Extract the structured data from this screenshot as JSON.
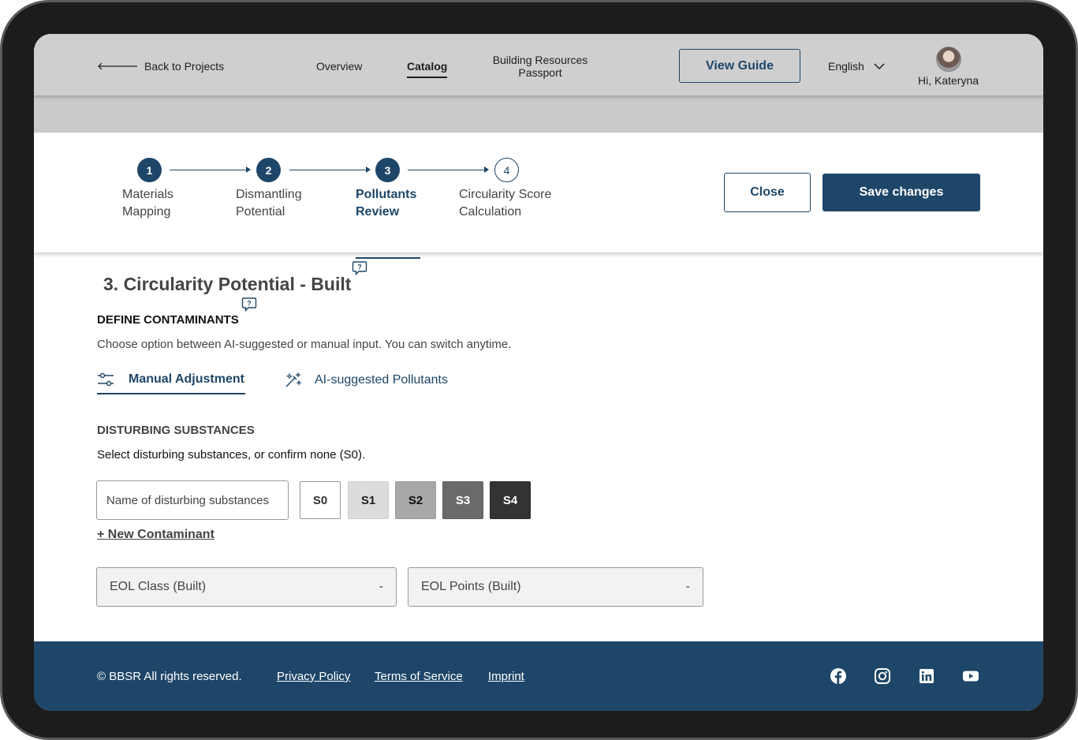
{
  "header": {
    "back_label": "Back to Projects",
    "nav": {
      "overview": "Overview",
      "catalog": "Catalog",
      "brp_line1": "Building Resources",
      "brp_line2": "Passport"
    },
    "view_guide": "View Guide",
    "language": "English",
    "greeting": "Hi, Kateryna"
  },
  "stepper": {
    "steps": [
      {
        "number": "1",
        "line1": "Materials",
        "line2": "Mapping",
        "state": "completed"
      },
      {
        "number": "2",
        "line1": "Dismantling",
        "line2": "Potential",
        "state": "completed"
      },
      {
        "number": "3",
        "line1": "Pollutants",
        "line2": "Review",
        "state": "active"
      },
      {
        "number": "4",
        "line1": "Circularity Score",
        "line2": "Calculation",
        "state": "upcoming"
      }
    ],
    "close_label": "Close",
    "save_label": "Save changes"
  },
  "main": {
    "section_title": "3. Circularity Potential - Built",
    "define_title": "DEFINE CONTAMINANTS",
    "define_desc": "Choose option between AI-suggested or manual input. You can switch anytime.",
    "tabs": {
      "manual": "Manual Adjustment",
      "ai": "AI-suggested Pollutants"
    },
    "disturbing_title": "DISTURBING SUBSTANCES",
    "disturbing_desc": "Select disturbing substances, or confirm none (S0).",
    "name_placeholder": "Name of disturbing substances",
    "levels": [
      "S0",
      "S1",
      "S2",
      "S3",
      "S4"
    ],
    "new_contaminant": "+ New Contaminant",
    "eol_class_label": "EOL Class (Built)",
    "eol_class_value": "-",
    "eol_points_label": "EOL Points (Built)",
    "eol_points_value": "-"
  },
  "footer": {
    "copyright": "© BBSR All rights reserved.",
    "privacy": "Privacy Policy",
    "terms": "Terms of Service",
    "imprint": "Imprint",
    "social_icons": [
      "facebook-icon",
      "instagram-icon",
      "linkedin-icon",
      "youtube-icon"
    ]
  },
  "colors": {
    "primary": "#1e4668",
    "header_bg": "#cfcfcf"
  }
}
